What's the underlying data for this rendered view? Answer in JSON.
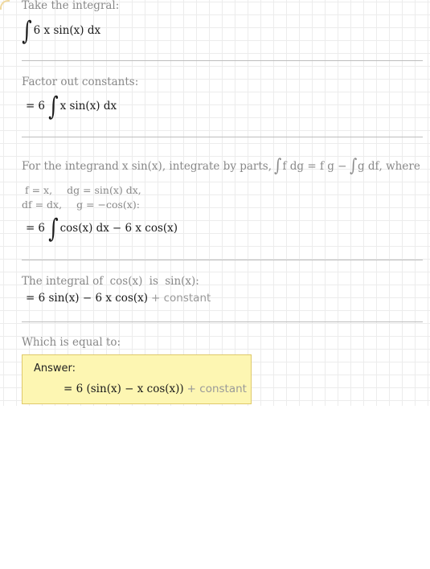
{
  "steps": {
    "s1": {
      "caption": "Take the integral:",
      "integrand": "6 x sin(x) dx"
    },
    "s2": {
      "caption": "Factor out constants:",
      "eq": "=",
      "coef": "6",
      "integrand": "x sin(x) dx"
    },
    "s3": {
      "caption_pre": "For the integrand",
      "caption_expr": "x sin(x)",
      "caption_mid": ", integrate by parts,",
      "formula_left": "f dg = f g −",
      "formula_right": "g df",
      "caption_post": ", where",
      "sub1_a": "f = x,",
      "sub1_b": "dg = sin(x) dx,",
      "sub2_a": "df = dx,",
      "sub2_b": "g = −cos(x):",
      "eq": "=",
      "coef": "6",
      "integrand": "cos(x) dx",
      "rest": "− 6 x cos(x)"
    },
    "s4": {
      "caption_pre": "The integral of",
      "caption_f": "cos(x)",
      "caption_mid": "is",
      "caption_g": "sin(x)",
      "caption_end": ":",
      "eq": "= 6 sin(x) − 6 x cos(x)",
      "constant": "+ constant"
    },
    "s5": {
      "caption": "Which is equal to:"
    }
  },
  "answer": {
    "label": "Answer:",
    "eq": "= 6 (sin(x) − x cos(x))",
    "constant": "+ constant"
  },
  "colors": {
    "answer_bg": "#fdf6b2",
    "answer_border": "#dfc96a",
    "caption": "#888888",
    "separator": "#bdbdbd"
  }
}
